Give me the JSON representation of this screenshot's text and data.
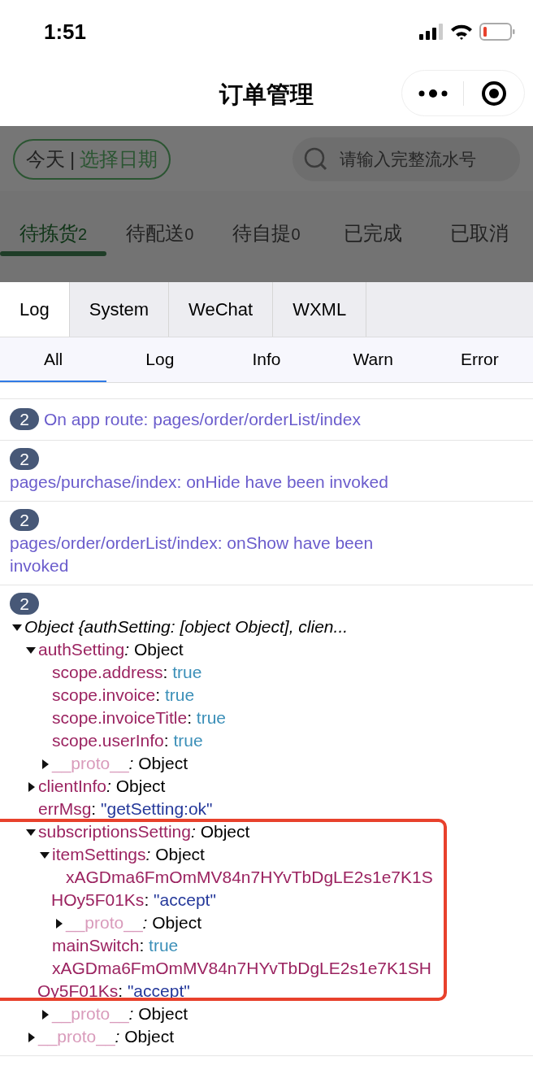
{
  "status_bar": {
    "time": "1:51"
  },
  "nav_bar": {
    "title": "订单管理"
  },
  "filters": {
    "date_today": "今天",
    "date_divider": "|",
    "date_pick": "选择日期",
    "search": {
      "placeholder": "请输入完整流水号"
    }
  },
  "order_tabs": [
    {
      "label": "待拣货",
      "count": "2",
      "selected": true
    },
    {
      "label": "待配送",
      "count": "0",
      "selected": false
    },
    {
      "label": "待自提",
      "count": "0",
      "selected": false
    },
    {
      "label": "已完成",
      "selected": false
    },
    {
      "label": "已取消",
      "selected": false
    }
  ],
  "console": {
    "tabs": [
      {
        "label": "Log",
        "selected": true
      },
      {
        "label": "System",
        "selected": false
      },
      {
        "label": "WeChat",
        "selected": false
      },
      {
        "label": "WXML",
        "selected": false
      }
    ],
    "levels": [
      {
        "label": "All",
        "selected": true
      },
      {
        "label": "Log",
        "selected": false
      },
      {
        "label": "Info",
        "selected": false
      },
      {
        "label": "Warn",
        "selected": false
      },
      {
        "label": "Error",
        "selected": false
      }
    ],
    "entries": [
      {
        "count": "2",
        "inline": true,
        "text": "On app route: pages/order/orderList/index"
      },
      {
        "count": "2",
        "inline": false,
        "text": "pages/purchase/index: onHide have been invoked"
      },
      {
        "count": "2",
        "inline": false,
        "text": "pages/order/orderList/index: onShow have been invoked"
      },
      {
        "count": "2",
        "inline": false,
        "tree": {
          "kind": "summary",
          "key": "Object {authSetting: [object Object], clien...",
          "expanded": true,
          "children": [
            {
              "kind": "object",
              "key": "authSetting",
              "sep": ":",
              "value": "Object",
              "expanded": true,
              "children": [
                {
                  "kind": "boolean",
                  "key": "scope.address",
                  "sep": ":",
                  "value": "true"
                },
                {
                  "kind": "boolean",
                  "key": "scope.invoice",
                  "sep": ":",
                  "value": "true"
                },
                {
                  "kind": "boolean",
                  "key": "scope.invoiceTitle",
                  "sep": ":",
                  "value": "true"
                },
                {
                  "kind": "boolean",
                  "key": "scope.userInfo",
                  "sep": ":",
                  "value": "true"
                },
                {
                  "kind": "proto",
                  "key": "__proto__",
                  "sep": ":",
                  "value": "Object",
                  "expanded": false
                }
              ]
            },
            {
              "kind": "object",
              "key": "clientInfo",
              "sep": ":",
              "value": "Object",
              "expanded": false
            },
            {
              "kind": "string",
              "key": "errMsg",
              "sep": ":",
              "value": "\"getSetting:ok\""
            },
            {
              "kind": "object",
              "key": "subscriptionsSetting",
              "sep": ":",
              "value": "Object",
              "expanded": true,
              "highlight": true,
              "children": [
                {
                  "kind": "object",
                  "key": "itemSettings",
                  "sep": ":",
                  "value": "Object",
                  "expanded": true,
                  "children": [
                    {
                      "kind": "string",
                      "key": "xAGDma6FmOmMV84n7HYvTbDgLE2s1e7K1SHOy5F01Ks",
                      "sep": ":",
                      "value": "\"accept\""
                    },
                    {
                      "kind": "proto",
                      "key": "__proto__",
                      "sep": ":",
                      "value": "Object",
                      "expanded": false
                    }
                  ]
                },
                {
                  "kind": "boolean",
                  "key": "mainSwitch",
                  "sep": ":",
                  "value": "true"
                },
                {
                  "kind": "string",
                  "key": "xAGDma6FmOmMV84n7HYvTbDgLE2s1e7K1SHOy5F01Ks",
                  "sep": ":",
                  "value": "\"accept\""
                },
                {
                  "kind": "proto",
                  "key": "__proto__",
                  "sep": ":",
                  "value": "Object",
                  "expanded": false
                }
              ]
            },
            {
              "kind": "proto",
              "key": "__proto__",
              "sep": ":",
              "value": "Object",
              "expanded": false
            }
          ]
        }
      }
    ]
  }
}
